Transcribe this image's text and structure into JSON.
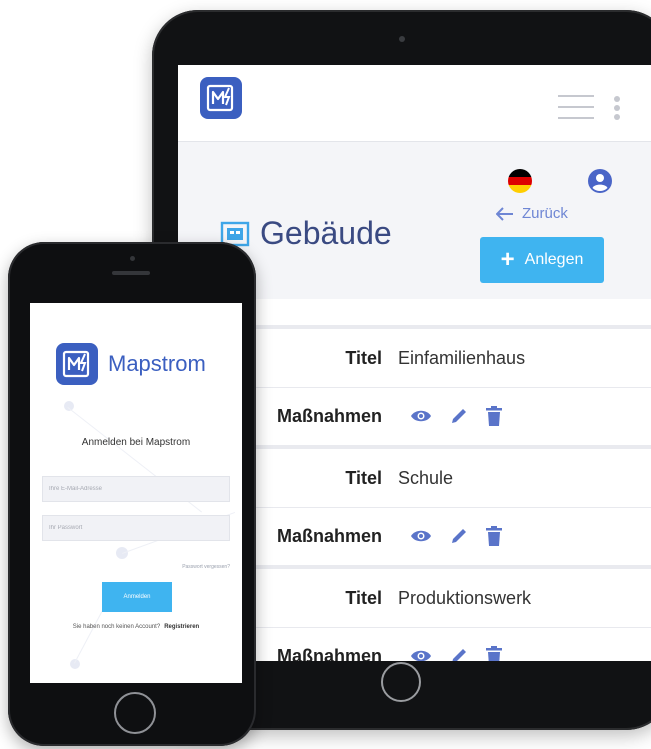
{
  "tablet": {
    "back_label": "Zurück",
    "page_title": "Gebäude",
    "create_button": "Anlegen",
    "entries": [
      {
        "title_label": "Titel",
        "title": "Einfamilienhaus",
        "actions_label": "Maßnahmen"
      },
      {
        "title_label": "Titel",
        "title": "Schule",
        "actions_label": "Maßnahmen"
      },
      {
        "title_label": "Titel",
        "title": "Produktionswerk",
        "actions_label": "Maßnahmen"
      }
    ],
    "icons": [
      "logo-icon",
      "hamburger-menu-icon",
      "kebab-menu-icon",
      "german-flag-icon",
      "user-account-icon",
      "back-arrow-icon",
      "building-icon",
      "plus-icon",
      "eye-icon",
      "pencil-icon",
      "trash-icon"
    ]
  },
  "phone": {
    "brand": "Mapstrom",
    "login_title": "Anmelden bei Mapstrom",
    "email_placeholder": "Ihre E-Mail-Adresse",
    "password_placeholder": "Ihr Passwort",
    "forgot_password": "Passwort vergessen?",
    "login_button": "Anmelden",
    "no_account_text": "Sie haben noch keinen Account?",
    "register_link": "Registrieren"
  },
  "colors": {
    "brand_blue": "#3b5fc0",
    "accent_button": "#3fb4f0",
    "icon_blue": "#5a74c9"
  }
}
